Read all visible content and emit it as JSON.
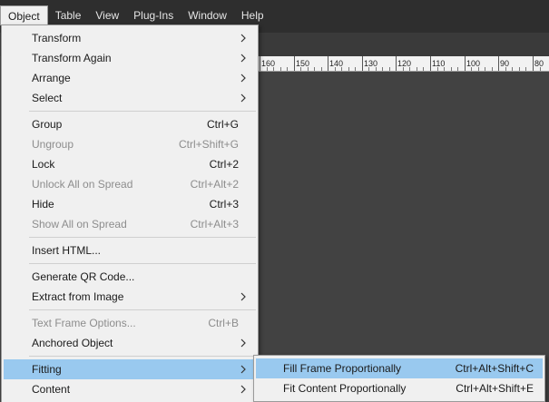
{
  "menubar": {
    "items": [
      "Object",
      "Table",
      "View",
      "Plug-Ins",
      "Window",
      "Help"
    ],
    "active": "Object"
  },
  "ruler": {
    "labels": [
      "160",
      "150",
      "140",
      "130",
      "120",
      "110",
      "100",
      "90",
      "80"
    ]
  },
  "object_menu": {
    "transform": "Transform",
    "transform_again": "Transform Again",
    "arrange": "Arrange",
    "select": "Select",
    "group": "Group",
    "group_shortcut": "Ctrl+G",
    "ungroup": "Ungroup",
    "ungroup_shortcut": "Ctrl+Shift+G",
    "lock": "Lock",
    "lock_shortcut": "Ctrl+2",
    "unlock_all": "Unlock All on Spread",
    "unlock_all_shortcut": "Ctrl+Alt+2",
    "hide": "Hide",
    "hide_shortcut": "Ctrl+3",
    "show_all": "Show All on Spread",
    "show_all_shortcut": "Ctrl+Alt+3",
    "insert_html": "Insert HTML...",
    "generate_qr": "Generate QR Code...",
    "extract_from_image": "Extract from Image",
    "text_frame_options": "Text Frame Options...",
    "text_frame_options_shortcut": "Ctrl+B",
    "anchored_object": "Anchored Object",
    "fitting": "Fitting",
    "content": "Content"
  },
  "fitting_submenu": {
    "fill_frame": "Fill Frame Proportionally",
    "fill_frame_shortcut": "Ctrl+Alt+Shift+C",
    "fit_content": "Fit Content Proportionally",
    "fit_content_shortcut": "Ctrl+Alt+Shift+E"
  },
  "colors": {
    "menubar_bg": "#2e2e2e",
    "canvas_bg": "#424242",
    "menu_bg": "#f0f0f0",
    "highlight": "#99c9ef",
    "disabled_text": "#8d8d8d"
  }
}
